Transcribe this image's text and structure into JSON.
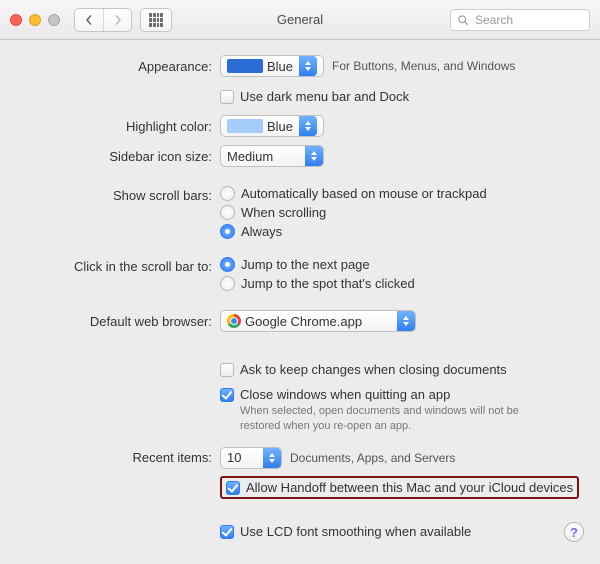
{
  "titlebar": {
    "title": "General",
    "search_placeholder": "Search"
  },
  "appearance": {
    "label": "Appearance:",
    "value": "Blue",
    "hint": "For Buttons, Menus, and Windows",
    "dark_menu": {
      "checked": false,
      "label": "Use dark menu bar and Dock"
    }
  },
  "highlight": {
    "label": "Highlight color:",
    "value": "Blue"
  },
  "sidebar_size": {
    "label": "Sidebar icon size:",
    "value": "Medium"
  },
  "scrollbars": {
    "label": "Show scroll bars:",
    "options": [
      "Automatically based on mouse or trackpad",
      "When scrolling",
      "Always"
    ],
    "selected": 2
  },
  "scrollclick": {
    "label": "Click in the scroll bar to:",
    "options": [
      "Jump to the next page",
      "Jump to the spot that's clicked"
    ],
    "selected": 0
  },
  "browser": {
    "label": "Default web browser:",
    "value": "Google Chrome.app"
  },
  "closing": {
    "ask": {
      "checked": false,
      "label": "Ask to keep changes when closing documents"
    },
    "closewin": {
      "checked": true,
      "label": "Close windows when quitting an app",
      "sub": "When selected, open documents and windows will not be restored when you re-open an app."
    }
  },
  "recent": {
    "label": "Recent items:",
    "value": "10",
    "suffix": "Documents, Apps, and Servers"
  },
  "handoff": {
    "checked": true,
    "label": "Allow Handoff between this Mac and your iCloud devices"
  },
  "lcd": {
    "checked": true,
    "label": "Use LCD font smoothing when available"
  },
  "help_glyph": "?"
}
